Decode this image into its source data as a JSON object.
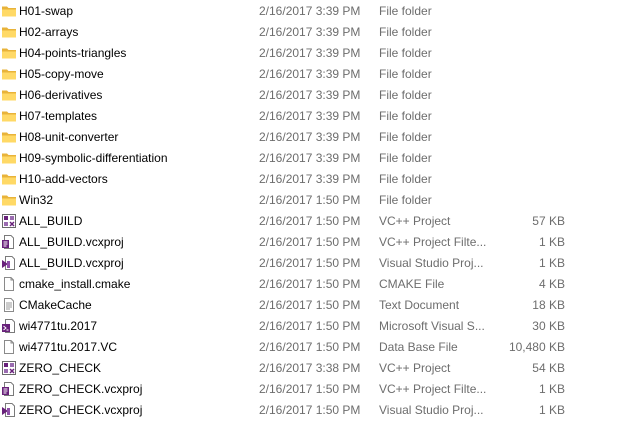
{
  "files": [
    {
      "name": "H01-swap",
      "date": "2/16/2017 3:39 PM",
      "type": "File folder",
      "size": "",
      "icon": "folder-icon"
    },
    {
      "name": "H02-arrays",
      "date": "2/16/2017 3:39 PM",
      "type": "File folder",
      "size": "",
      "icon": "folder-icon"
    },
    {
      "name": "H04-points-triangles",
      "date": "2/16/2017 3:39 PM",
      "type": "File folder",
      "size": "",
      "icon": "folder-icon"
    },
    {
      "name": "H05-copy-move",
      "date": "2/16/2017 3:39 PM",
      "type": "File folder",
      "size": "",
      "icon": "folder-icon"
    },
    {
      "name": "H06-derivatives",
      "date": "2/16/2017 3:39 PM",
      "type": "File folder",
      "size": "",
      "icon": "folder-icon"
    },
    {
      "name": "H07-templates",
      "date": "2/16/2017 3:39 PM",
      "type": "File folder",
      "size": "",
      "icon": "folder-icon"
    },
    {
      "name": "H08-unit-converter",
      "date": "2/16/2017 3:39 PM",
      "type": "File folder",
      "size": "",
      "icon": "folder-icon"
    },
    {
      "name": "H09-symbolic-differentiation",
      "date": "2/16/2017 3:39 PM",
      "type": "File folder",
      "size": "",
      "icon": "folder-icon"
    },
    {
      "name": "H10-add-vectors",
      "date": "2/16/2017 3:39 PM",
      "type": "File folder",
      "size": "",
      "icon": "folder-icon"
    },
    {
      "name": "Win32",
      "date": "2/16/2017 1:50 PM",
      "type": "File folder",
      "size": "",
      "icon": "folder-icon"
    },
    {
      "name": "ALL_BUILD",
      "date": "2/16/2017 1:50 PM",
      "type": "VC++ Project",
      "size": "57 KB",
      "icon": "vcxproj-icon"
    },
    {
      "name": "ALL_BUILD.vcxproj",
      "date": "2/16/2017 1:50 PM",
      "type": "VC++ Project Filte...",
      "size": "1 KB",
      "icon": "vcxproj-filters-icon"
    },
    {
      "name": "ALL_BUILD.vcxproj",
      "date": "2/16/2017 1:50 PM",
      "type": "Visual Studio Proj...",
      "size": "1 KB",
      "icon": "vs-project-user-icon"
    },
    {
      "name": "cmake_install.cmake",
      "date": "2/16/2017 1:50 PM",
      "type": "CMAKE File",
      "size": "4 KB",
      "icon": "blank-file-icon"
    },
    {
      "name": "CMakeCache",
      "date": "2/16/2017 1:50 PM",
      "type": "Text Document",
      "size": "18 KB",
      "icon": "text-document-icon"
    },
    {
      "name": "wi4771tu.2017",
      "date": "2/16/2017 1:50 PM",
      "type": "Microsoft Visual S...",
      "size": "30 KB",
      "icon": "vs-solution-icon"
    },
    {
      "name": "wi4771tu.2017.VC",
      "date": "2/16/2017 1:50 PM",
      "type": "Data Base File",
      "size": "10,480 KB",
      "icon": "database-file-icon"
    },
    {
      "name": "ZERO_CHECK",
      "date": "2/16/2017 3:38 PM",
      "type": "VC++ Project",
      "size": "54 KB",
      "icon": "vcxproj-icon"
    },
    {
      "name": "ZERO_CHECK.vcxproj",
      "date": "2/16/2017 1:50 PM",
      "type": "VC++ Project Filte...",
      "size": "1 KB",
      "icon": "vcxproj-filters-icon"
    },
    {
      "name": "ZERO_CHECK.vcxproj",
      "date": "2/16/2017 1:50 PM",
      "type": "Visual Studio Proj...",
      "size": "1 KB",
      "icon": "vs-project-user-icon"
    }
  ]
}
